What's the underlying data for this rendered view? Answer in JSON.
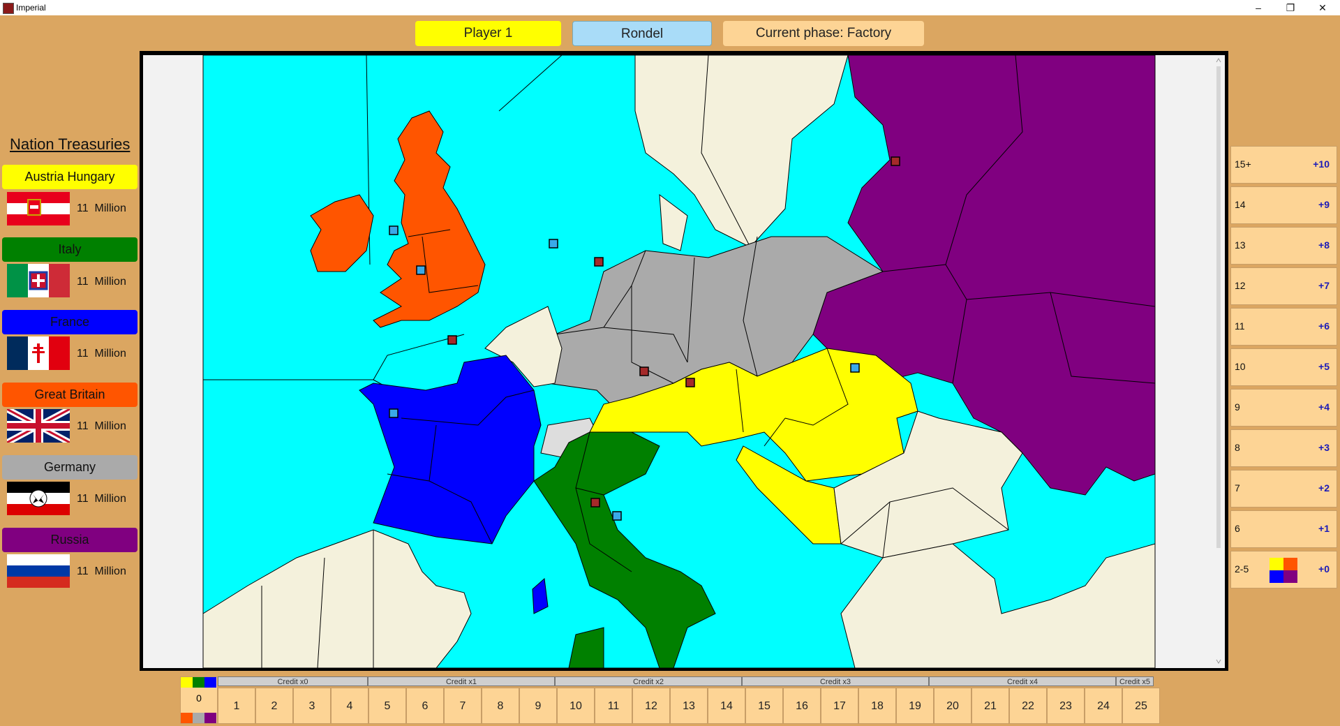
{
  "window": {
    "title": "Imperial",
    "minimize_glyph": "–",
    "maximize_glyph": "❐",
    "close_glyph": "✕"
  },
  "header": {
    "player_label": "Player 1",
    "rondel_label": "Rondel",
    "phase_label": "Current phase: Factory"
  },
  "colors": {
    "background": "#dba661",
    "austria": "#ffff00",
    "italy": "#008000",
    "france": "#0000ff",
    "britain": "#ff5500",
    "germany": "#aaaaaa",
    "russia": "#800080",
    "sea": "#00ffff",
    "neutral": "#f4f1dc",
    "player_button": "#ffff00",
    "rondel_button": "#a9dcf8",
    "phase_button": "#fdd495"
  },
  "sidebar": {
    "title": "Nation Treasuries",
    "nations": [
      {
        "name": "Austria Hungary",
        "amount": "11",
        "unit": "Million",
        "color": "#ffff00",
        "flag_icon": "austria-flag-icon"
      },
      {
        "name": "Italy",
        "amount": "11",
        "unit": "Million",
        "color": "#008000",
        "flag_icon": "italy-flag-icon"
      },
      {
        "name": "France",
        "amount": "11",
        "unit": "Million",
        "color": "#0000ff",
        "flag_icon": "france-flag-icon"
      },
      {
        "name": "Great Britain",
        "amount": "11",
        "unit": "Million",
        "color": "#ff5500",
        "flag_icon": "britain-flag-icon"
      },
      {
        "name": "Germany",
        "amount": "11",
        "unit": "Million",
        "color": "#aaaaaa",
        "flag_icon": "germany-flag-icon"
      },
      {
        "name": "Russia",
        "amount": "11",
        "unit": "Million",
        "color": "#800080",
        "flag_icon": "russia-flag-icon"
      }
    ]
  },
  "power_scale": [
    {
      "points": "15+",
      "bonus": "+10"
    },
    {
      "points": "14",
      "bonus": "+9"
    },
    {
      "points": "13",
      "bonus": "+8"
    },
    {
      "points": "12",
      "bonus": "+7"
    },
    {
      "points": "11",
      "bonus": "+6"
    },
    {
      "points": "10",
      "bonus": "+5"
    },
    {
      "points": "9",
      "bonus": "+4"
    },
    {
      "points": "8",
      "bonus": "+3"
    },
    {
      "points": "7",
      "bonus": "+2"
    },
    {
      "points": "6",
      "bonus": "+1"
    },
    {
      "points": "2-5",
      "bonus": "+0"
    }
  ],
  "bond_track": {
    "start_cell": "0",
    "credit_labels": [
      "Credit x0",
      "Credit x1",
      "Credit x2",
      "Credit x3",
      "Credit x4",
      "Credit x5"
    ],
    "cells": [
      "1",
      "2",
      "3",
      "4",
      "5",
      "6",
      "7",
      "8",
      "9",
      "10",
      "11",
      "12",
      "13",
      "14",
      "15",
      "16",
      "17",
      "18",
      "19",
      "20",
      "21",
      "22",
      "23",
      "24",
      "25"
    ]
  }
}
